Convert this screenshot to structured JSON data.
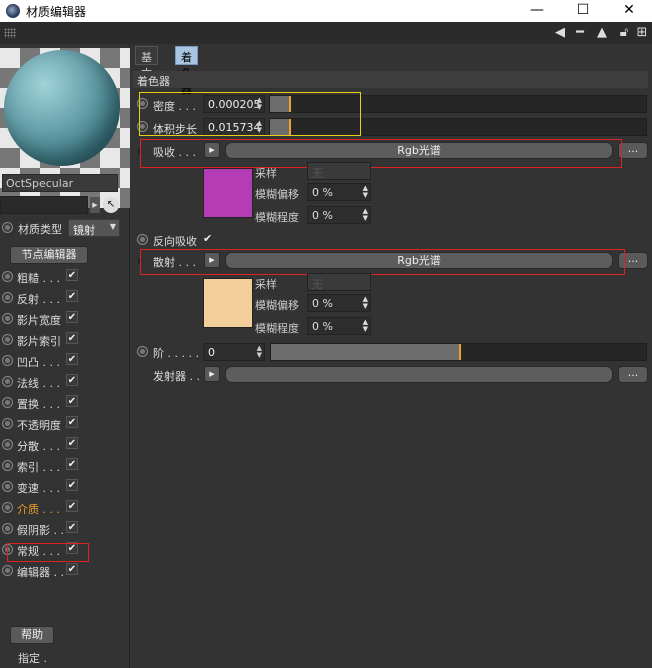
{
  "window": {
    "title": "材质编辑器",
    "min_glyph": "—",
    "max_glyph": "☐",
    "close_glyph": "✕"
  },
  "toolbar": {
    "icons": [
      "arrow-left-icon",
      "cursor-arrow-icon",
      "lock-icon",
      "new-window-icon"
    ]
  },
  "left": {
    "material_name": "OctSpecular",
    "material_type_label": "材质类型",
    "material_type_value": "镜射",
    "node_editor_button": "节点编辑器",
    "channels": [
      {
        "label": "粗糙 . . .",
        "checked": true,
        "active": false
      },
      {
        "label": "反射 . . .",
        "checked": true,
        "active": false
      },
      {
        "label": "影片宽度",
        "checked": true,
        "active": false
      },
      {
        "label": "影片索引",
        "checked": true,
        "active": false
      },
      {
        "label": "凹凸 . . .",
        "checked": true,
        "active": false
      },
      {
        "label": "法线 . . .",
        "checked": true,
        "active": false
      },
      {
        "label": "置换 . . .",
        "checked": true,
        "active": false
      },
      {
        "label": "不透明度",
        "checked": true,
        "active": false
      },
      {
        "label": "分散 . . .",
        "checked": true,
        "active": false
      },
      {
        "label": "索引 . . .",
        "checked": true,
        "active": false
      },
      {
        "label": "变速 . . .",
        "checked": true,
        "active": false
      },
      {
        "label": "介质 . . .",
        "checked": true,
        "active": true
      },
      {
        "label": "假阴影 . .",
        "checked": true,
        "active": false
      },
      {
        "label": "常规 . . .",
        "checked": true,
        "active": false
      },
      {
        "label": "编辑器 . .",
        "checked": true,
        "active": false
      }
    ],
    "help_button": "帮助",
    "assign_label": "指定 ."
  },
  "tabs": [
    {
      "label": "基本",
      "active": false
    },
    {
      "label": "着色器",
      "active": true
    }
  ],
  "section_title": "着色器",
  "density": {
    "label": "密度 . . .",
    "value": "0.000205",
    "slider_fraction": 0.05
  },
  "step": {
    "label": "体积步长",
    "value": "0.015734",
    "slider_fraction": 0.05
  },
  "absorption": {
    "label": "吸收 . . .",
    "shader_button": "Rgb光谱",
    "more": "...",
    "swatch_color": "#b43cb4",
    "sampling_label": "采样",
    "sampling_value": "无",
    "blur_offset_label": "模糊偏移",
    "blur_offset_value": "0 %",
    "blur_scale_label": "模糊程度",
    "blur_scale_value": "0 %"
  },
  "invert_absorption": {
    "label": "反向吸收",
    "checked": true
  },
  "scattering": {
    "label": "散射 . . .",
    "shader_button": "Rgb光谱",
    "more": "...",
    "swatch_color": "#f3cf9b",
    "sampling_label": "采样",
    "sampling_value": "无",
    "blur_offset_label": "模糊偏移",
    "blur_offset_value": "0 %",
    "blur_scale_label": "模糊程度",
    "blur_scale_value": "0 %"
  },
  "phase": {
    "label": "阶 . . . . .",
    "value": "0",
    "slider_fraction": 0.5
  },
  "emitter": {
    "label": "发射器 . .",
    "more": "..."
  },
  "colors": {
    "accent": "#f0a030",
    "tab_active": "#a9c4e2",
    "highlight_yellow": "#e8d010",
    "highlight_red": "#dd2222"
  }
}
